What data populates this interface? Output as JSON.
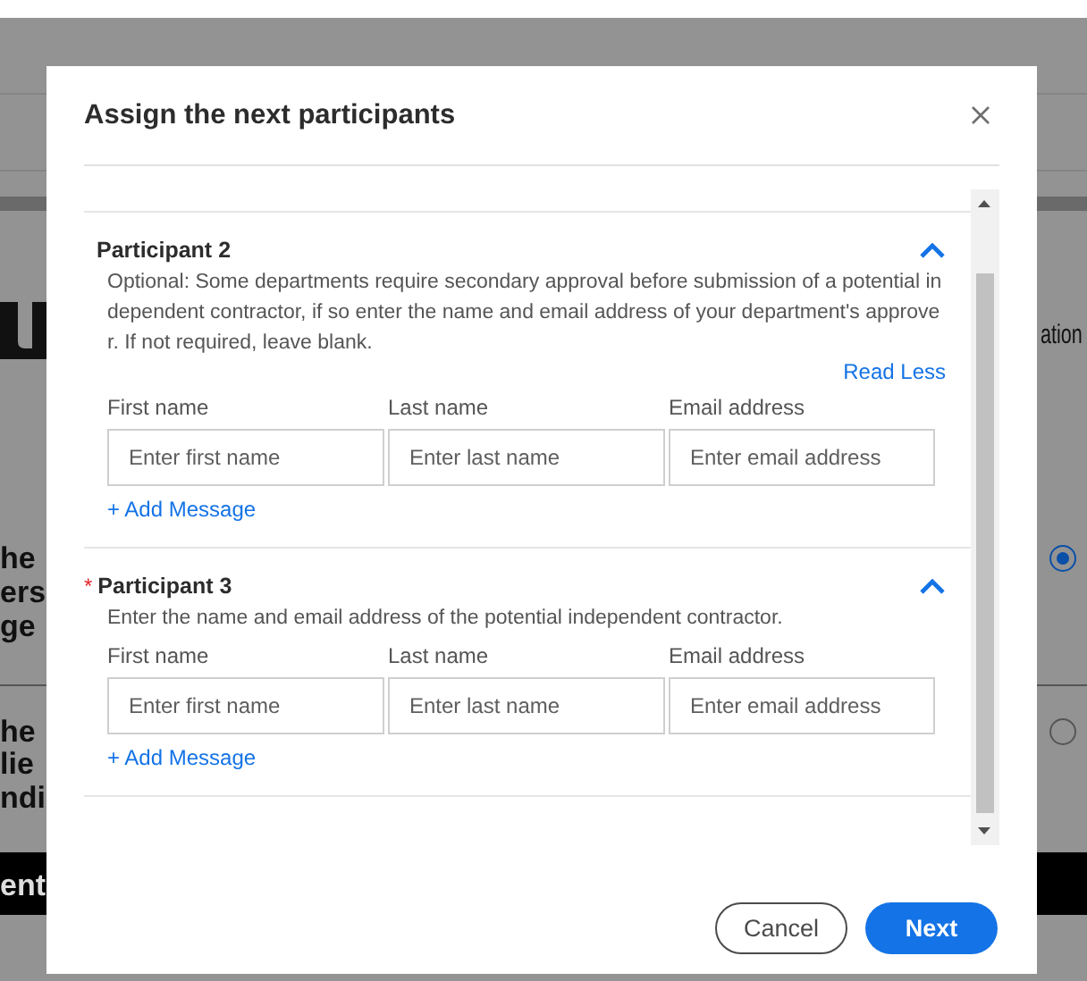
{
  "background": {
    "fragments": [
      {
        "text": "he",
        "kind": "dark"
      },
      {
        "text": "ers",
        "kind": "dark"
      },
      {
        "text": "ge",
        "kind": "dark"
      },
      {
        "text": "he",
        "kind": "dark"
      },
      {
        "text": "lie",
        "kind": "dark"
      },
      {
        "text": "ndi",
        "kind": "dark"
      },
      {
        "text": "ent",
        "kind": "light"
      },
      {
        "text": "ation",
        "kind": "narrow"
      }
    ],
    "radios": [
      {
        "selected": true
      },
      {
        "selected": false
      }
    ]
  },
  "dialog": {
    "title": "Assign the next participants",
    "participants": [
      {
        "title": "Participant 2",
        "expanded": true,
        "description": "Optional: Some departments require secondary approval before submission of a potential independent contractor, if so enter the name and email address of your department's approver. If not required, leave blank.",
        "toggle_link": "Read Less",
        "fields": [
          {
            "label": "First name",
            "placeholder": "Enter first name"
          },
          {
            "label": "Last name",
            "placeholder": "Enter last name"
          },
          {
            "label": "Email address",
            "placeholder": "Enter email address"
          }
        ],
        "add_message": "+ Add Message"
      },
      {
        "title": "Participant 3",
        "required_mark": "*",
        "expanded": true,
        "description": "Enter the name and email address of the potential independent contractor.",
        "fields": [
          {
            "label": "First name",
            "placeholder": "Enter first name"
          },
          {
            "label": "Last name",
            "placeholder": "Enter last name"
          },
          {
            "label": "Email address",
            "placeholder": "Enter email address"
          }
        ],
        "add_message": "+ Add Message"
      }
    ],
    "buttons": [
      {
        "label": "Cancel",
        "kind": "secondary"
      },
      {
        "label": "Next",
        "kind": "primary"
      }
    ]
  }
}
